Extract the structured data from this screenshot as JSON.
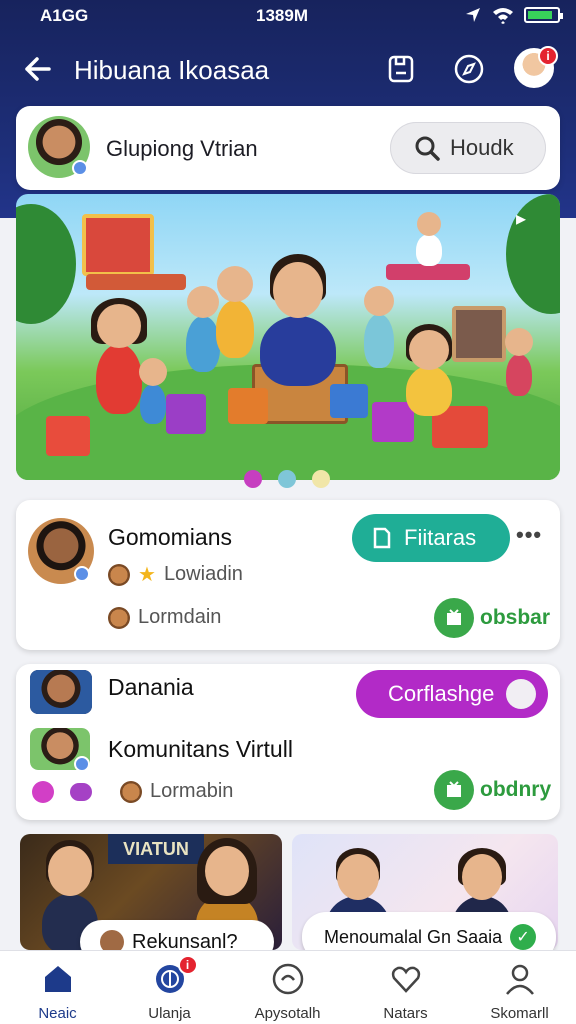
{
  "status_bar": {
    "carrier": "A1GG",
    "time": "1389M"
  },
  "header": {
    "title": "Hibuana Ikoasaa",
    "avatar_badge": "i"
  },
  "profile": {
    "name": "Glupiong Vtrian"
  },
  "search": {
    "label": "Houdk"
  },
  "banner": {
    "dots": [
      "#c63ec0",
      "#7fc6d8",
      "#f1e6a8"
    ]
  },
  "card1": {
    "title": "Gomomians",
    "subtitle": "Lowiadin",
    "meta": "Lormdain",
    "action": "Fiitaras",
    "status": "obsbar"
  },
  "card2": {
    "title1": "Danania",
    "title2": "Komunitans Virtull",
    "meta": "Lormabin",
    "action": "Corflashge",
    "status": "obdnry"
  },
  "thumbs": {
    "left_caption": "Rekunsanl?",
    "left_sign": "VIATUN",
    "right_caption": "Menoumalal Gn Saaia"
  },
  "bottom_nav": {
    "tabs": [
      {
        "label": "Neaic",
        "icon": "home-icon"
      },
      {
        "label": "Ulanja",
        "icon": "globe-icon",
        "badge": "i"
      },
      {
        "label": "Apysotalh",
        "icon": "activity-icon"
      },
      {
        "label": "Natars",
        "icon": "heart-icon"
      },
      {
        "label": "Skomarll",
        "icon": "profile-icon"
      }
    ]
  },
  "colors": {
    "header": "#1e2f7a",
    "accent_teal": "#1fae96",
    "accent_purple": "#b22ac7",
    "status_green": "#2d9b3e"
  }
}
